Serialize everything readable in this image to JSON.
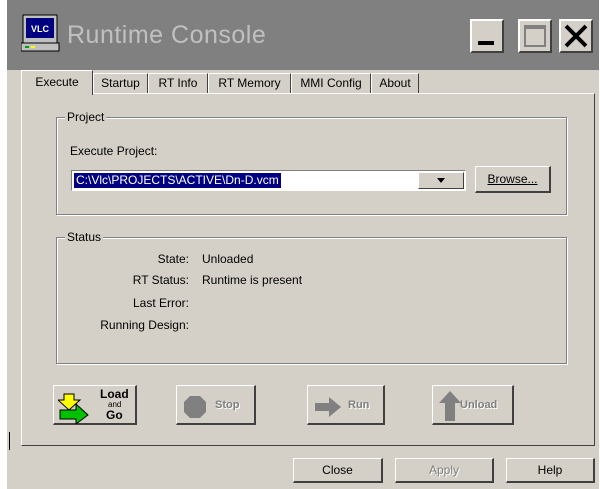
{
  "window": {
    "title": "Runtime Console"
  },
  "tabs": [
    {
      "label": "Execute",
      "active": true
    },
    {
      "label": "Startup"
    },
    {
      "label": "RT Info"
    },
    {
      "label": "RT Memory"
    },
    {
      "label": "MMI Config"
    },
    {
      "label": "About"
    }
  ],
  "project": {
    "group_label": "Project",
    "execute_label": "Execute Project:",
    "path_value": "C:\\Vlc\\PROJECTS\\ACTIVE\\Dn-D.vcm",
    "browse_label": "Browse..."
  },
  "status": {
    "group_label": "Status",
    "state_label": "State:",
    "state_value": "Unloaded",
    "rt_status_label": "RT Status:",
    "rt_status_value": "Runtime is present",
    "last_error_label": "Last Error:",
    "last_error_value": "",
    "running_design_label": "Running Design:",
    "running_design_value": ""
  },
  "actions": {
    "load_line1": "Load",
    "load_line2": "and",
    "load_line3": "Go",
    "stop": "Stop",
    "run": "Run",
    "unload": "Unload"
  },
  "footer": {
    "close": "Close",
    "apply": "Apply",
    "help": "Help"
  },
  "icons": {
    "app": "vlc-app-icon",
    "minimize": "minimize-icon",
    "maximize": "maximize-icon",
    "close": "close-icon",
    "load": "load-and-go-icon",
    "stop": "stop-icon",
    "run": "run-arrow-icon",
    "unload": "unload-arrow-icon"
  },
  "colors": {
    "titlebar": "#808080",
    "face": "#d4d0c8",
    "selection": "#000080",
    "load_yellow": "#ffff00",
    "load_green": "#00c000"
  }
}
